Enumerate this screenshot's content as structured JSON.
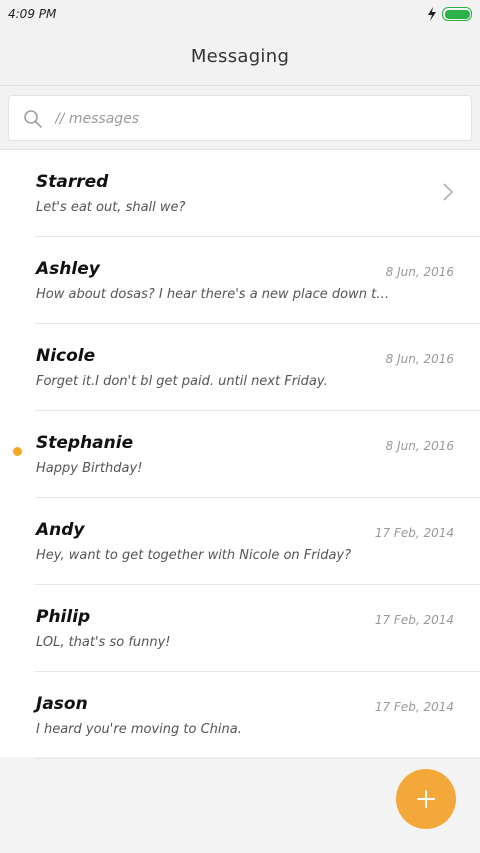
{
  "status_bar": {
    "time": "4:09 PM",
    "battery_level": 1.0,
    "battery_color": "#2cb24a",
    "icons": [
      "charging-bolt-icon",
      "battery-icon"
    ]
  },
  "header": {
    "title": "Messaging"
  },
  "search": {
    "placeholder": "// messages",
    "value": ""
  },
  "conversations": [
    {
      "name": "Starred",
      "date": "",
      "preview": "Let's eat out, shall we?",
      "unread": false,
      "has_chevron": true
    },
    {
      "name": "Ashley",
      "date": "8 Jun, 2016",
      "preview": "How about dosas? I hear there's a new place down the...",
      "unread": false,
      "has_chevron": false
    },
    {
      "name": "Nicole",
      "date": "8 Jun, 2016",
      "preview": "Forget it.I don't bl get paid. until next Friday.",
      "unread": false,
      "has_chevron": false
    },
    {
      "name": "Stephanie",
      "date": "8 Jun, 2016",
      "preview": "Happy Birthday!",
      "unread": true,
      "has_chevron": false
    },
    {
      "name": "Andy",
      "date": "17 Feb, 2014",
      "preview": "Hey, want to get together with Nicole on Friday?",
      "unread": false,
      "has_chevron": false
    },
    {
      "name": "Philip",
      "date": "17 Feb, 2014",
      "preview": "LOL, that's so funny!",
      "unread": false,
      "has_chevron": false
    },
    {
      "name": "Jason",
      "date": "17 Feb, 2014",
      "preview": "I heard you're moving to China.",
      "unread": false,
      "has_chevron": false
    }
  ],
  "fab": {
    "icon": "plus-icon",
    "color": "#f5a83a"
  },
  "colors": {
    "accent": "#f5a623",
    "unread_dot": "#f5a623"
  }
}
